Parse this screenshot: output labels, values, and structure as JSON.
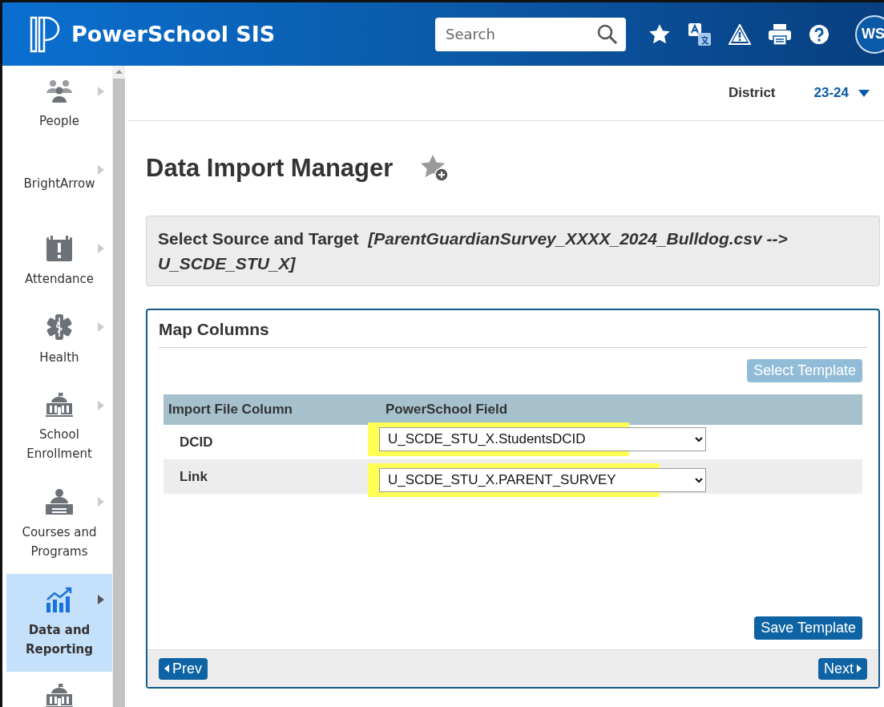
{
  "header": {
    "title": "PowerSchool SIS",
    "search": {
      "placeholder": "Search"
    },
    "avatar": "WS"
  },
  "sidebar": {
    "items": [
      {
        "kind": "people",
        "label": "People",
        "selected": false
      },
      {
        "kind": "blank",
        "label": "BrightArrow",
        "selected": false
      },
      {
        "kind": "calendar",
        "label": "Attendance",
        "selected": false
      },
      {
        "kind": "health",
        "label": "Health",
        "selected": false
      },
      {
        "kind": "school",
        "label": "School Enrollment",
        "selected": false
      },
      {
        "kind": "teacher",
        "label": "Courses and Programs",
        "selected": false
      },
      {
        "kind": "chart",
        "label": "Data and Reporting",
        "selected": true
      },
      {
        "kind": "school",
        "selected": false
      }
    ]
  },
  "topbar": {
    "scope": "District",
    "term": "23-24"
  },
  "page": {
    "title": "Data Import Manager",
    "source_target": {
      "label": "Select Source and Target",
      "value": "[ParentGuardianSurvey_XXXX_2024_Bulldog.csv --> U_SCDE_STU_X]"
    },
    "panel": {
      "title": "Map Columns",
      "select_template": {
        "label": "Select Template",
        "disabled": true
      },
      "table": {
        "columns": [
          "Import File Column",
          "PowerSchool Field"
        ],
        "rows": [
          {
            "column": "DCID",
            "field": "U_SCDE_STU_X.StudentsDCID",
            "highlighted": true
          },
          {
            "column": "Link",
            "field": "U_SCDE_STU_X.PARENT_SURVEY",
            "highlighted": true
          }
        ]
      },
      "save_template": {
        "label": "Save Template",
        "disabled": false
      },
      "prev": "Prev",
      "next": "Next"
    }
  }
}
